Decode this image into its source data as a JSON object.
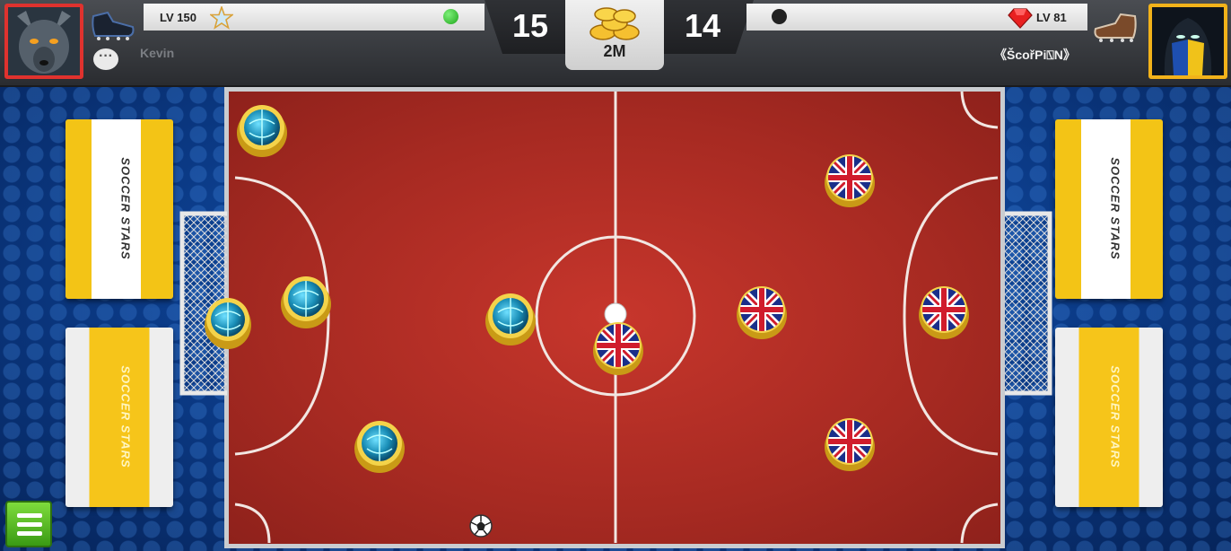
{
  "players": {
    "left": {
      "level": "LV 150",
      "name": "Kevin",
      "score": "15",
      "status_color": "#2ecc40"
    },
    "right": {
      "level": "LV 81",
      "name": "《ŠcořPi⍂N》",
      "score": "14",
      "status_color": "#222222"
    }
  },
  "pot": {
    "value": "2M"
  },
  "banners": {
    "brand": "SOCCER STARS"
  },
  "colors": {
    "left_frame": "#e0322e",
    "right_frame": "#f2b21a",
    "pitch": "#b2302a",
    "menu": "#5cc22a"
  },
  "pieces": {
    "left_team": "globe-cap",
    "right_team": "union-jack-cap"
  },
  "icons": [
    "wolf-avatar",
    "masked-avatar",
    "boot-icon",
    "star-icon",
    "gem-icon",
    "chat-icon",
    "coins-icon",
    "menu-icon",
    "ball-icon"
  ]
}
